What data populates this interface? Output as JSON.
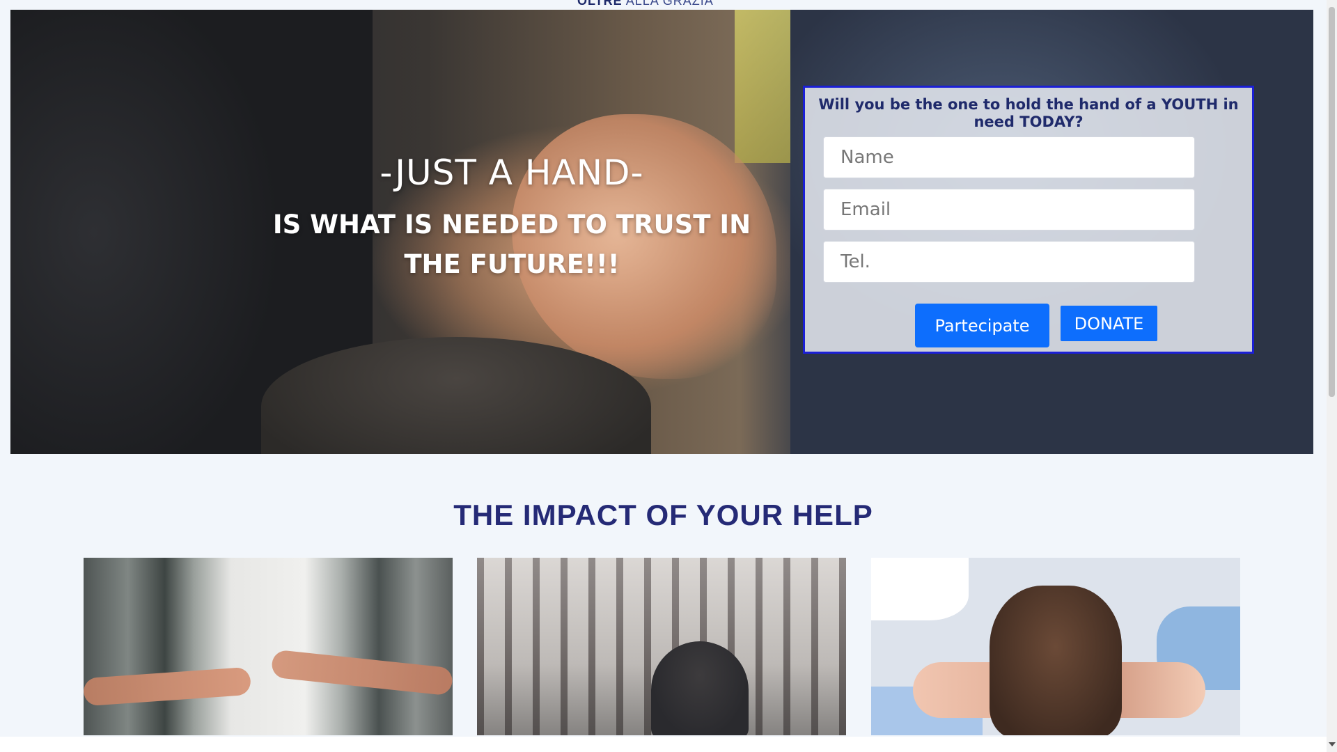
{
  "header": {
    "logo_bold": "OLTRE",
    "logo_light": "ALLA GRAZIA"
  },
  "hero": {
    "title": "-JUST A HAND-",
    "subtitle": "IS WHAT IS NEEDED TO TRUST IN THE FUTURE!!!"
  },
  "form": {
    "question": "Will you be the one to hold the hand of a YOUTH in need TODAY?",
    "name_placeholder": "Name",
    "email_placeholder": "Email",
    "tel_placeholder": "Tel.",
    "participate_label": "Partecipate",
    "donate_label": "DONATE",
    "accent_color": "#0d6efd",
    "border_color": "#1b1fd6"
  },
  "impact": {
    "title": "THE IMPACT OF YOUR HELP",
    "cards": [
      {
        "image": "reaching-hands-photo"
      },
      {
        "image": "sad-youth-photo"
      },
      {
        "image": "stacked-hands-photo"
      }
    ]
  }
}
